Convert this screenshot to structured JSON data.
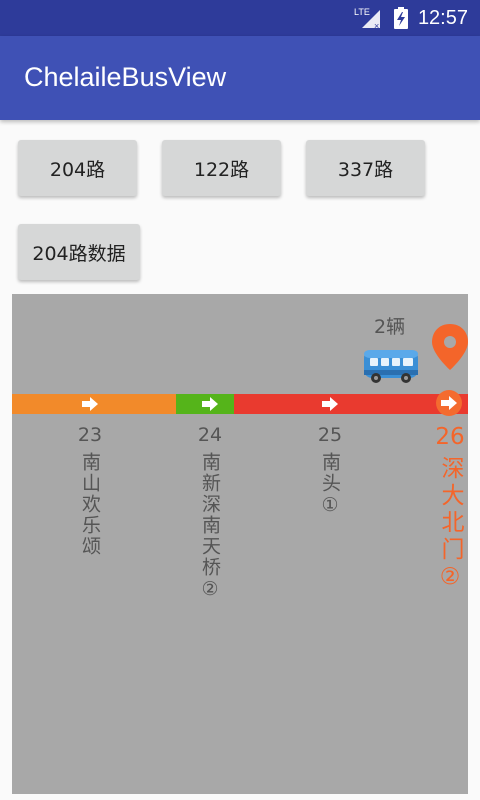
{
  "status_bar": {
    "network": "LTE",
    "time": "12:57"
  },
  "app_bar": {
    "title": "ChelaileBusView"
  },
  "buttons": {
    "route_204": "204路",
    "route_122": "122路",
    "route_337": "337路",
    "route_204_data": "204路数据"
  },
  "route_view": {
    "vehicle_count": "2辆",
    "colors": {
      "orange": "#f28a2a",
      "green": "#55b41a",
      "red": "#e93a2f",
      "active": "#f4652a",
      "panel": "#a8a8a8"
    },
    "stops": [
      {
        "number": "23",
        "name": "南山欢乐颂"
      },
      {
        "number": "24",
        "name": "南新深南天桥②"
      },
      {
        "number": "25",
        "name": "南头①"
      },
      {
        "number": "26",
        "name": "深大北门②"
      }
    ]
  }
}
